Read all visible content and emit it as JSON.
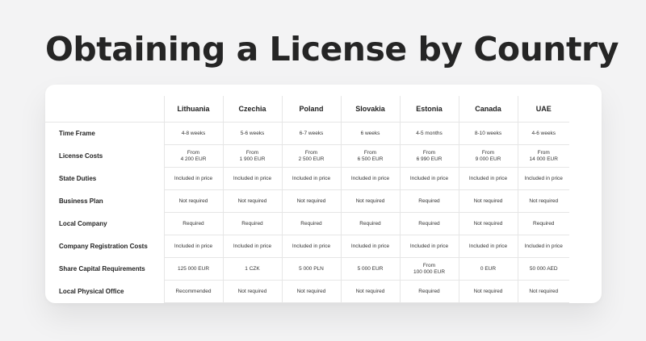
{
  "title": "Obtaining a License by Country",
  "table": {
    "countries": [
      "Lithuania",
      "Czechia",
      "Poland",
      "Slovakia",
      "Estonia",
      "Canada",
      "UAE"
    ],
    "rows": [
      {
        "label": "Time Frame",
        "values": [
          "4-8 weeks",
          "5-6 weeks",
          "6-7 weeks",
          "6 weeks",
          "4-5 months",
          "8-10 weeks",
          "4-6 weeks"
        ]
      },
      {
        "label": "License Costs",
        "values": [
          "From\n4 200 EUR",
          "From\n1 900 EUR",
          "From\n2 500 EUR",
          "From\n6 500 EUR",
          "From\n6 990 EUR",
          "From\n9 000 EUR",
          "From\n14 000 EUR"
        ]
      },
      {
        "label": "State Duties",
        "values": [
          "Included in price",
          "Included in price",
          "Included in price",
          "Included in price",
          "Included in price",
          "Included in price",
          "Included in price"
        ]
      },
      {
        "label": "Business Plan",
        "values": [
          "Not required",
          "Not required",
          "Not required",
          "Not required",
          "Required",
          "Not required",
          "Not required"
        ]
      },
      {
        "label": "Local Company",
        "values": [
          "Required",
          "Required",
          "Required",
          "Required",
          "Required",
          "Not required",
          "Required"
        ]
      },
      {
        "label": "Company Registration Costs",
        "values": [
          "Included in price",
          "Included in price",
          "Included in price",
          "Included in price",
          "Included in price",
          "Included in price",
          "Included in price"
        ]
      },
      {
        "label": "Share Capital Requirements",
        "values": [
          "125 000 EUR",
          "1 CZK",
          "5 000 PLN",
          "5 000 EUR",
          "From\n100 000 EUR",
          "0 EUR",
          "50 000 AED"
        ]
      },
      {
        "label": "Local Physical Office",
        "values": [
          "Recommended",
          "Not required",
          "Not required",
          "Not required",
          "Required",
          "Not required",
          "Not required"
        ]
      }
    ]
  }
}
